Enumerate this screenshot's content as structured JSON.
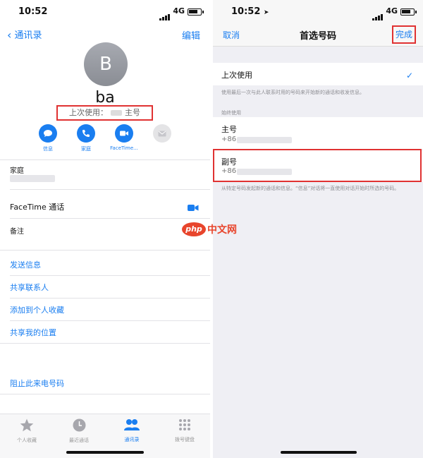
{
  "left": {
    "status": {
      "time": "10:52",
      "network": "4G"
    },
    "nav": {
      "back_label": "通讯录",
      "edit_label": "编辑"
    },
    "contact": {
      "initial": "B",
      "name": "ba",
      "last_used_prefix": "上次使用：",
      "last_used_value": "主号"
    },
    "actions": [
      {
        "label": "信息",
        "icon": "message-icon",
        "enabled": true
      },
      {
        "label": "家庭",
        "icon": "phone-icon",
        "enabled": true
      },
      {
        "label": "FaceTime...",
        "icon": "video-icon",
        "enabled": true
      },
      {
        "label": "邮件",
        "icon": "mail-icon",
        "enabled": false
      }
    ],
    "fields": {
      "home_label": "家庭",
      "facetime_label": "FaceTime 通话",
      "notes_label": "备注"
    },
    "links": [
      "发送信息",
      "共享联系人",
      "添加到个人收藏",
      "共享我的位置"
    ],
    "block_label": "阻止此来电号码",
    "tabs": [
      {
        "label": "个人收藏",
        "icon": "star-icon",
        "active": false
      },
      {
        "label": "最近通话",
        "icon": "clock-icon",
        "active": false
      },
      {
        "label": "通讯录",
        "icon": "contacts-icon",
        "active": true
      },
      {
        "label": "拨号键盘",
        "icon": "keypad-icon",
        "active": false
      }
    ]
  },
  "right": {
    "status": {
      "time": "10:52",
      "network": "4G"
    },
    "nav": {
      "cancel_label": "取消",
      "title": "首选号码",
      "done_label": "完成"
    },
    "last_used_label": "上次使用",
    "last_used_footer": "使用最后一次与此人联系时用的号码来开始新的通话和收发信息。",
    "always_use_header": "始终使用",
    "numbers": [
      {
        "label": "主号",
        "prefix": "+86"
      },
      {
        "label": "副号",
        "prefix": "+86"
      }
    ],
    "footer": "从特定号码发起新的通话和信息。“信息”对话将一直使用对话开始时所选的号码。"
  },
  "watermark": {
    "logo": "php",
    "text": "中文网"
  },
  "colors": {
    "accent": "#1a7ef0",
    "highlight": "#e03232",
    "watermark": "#e8452c"
  }
}
